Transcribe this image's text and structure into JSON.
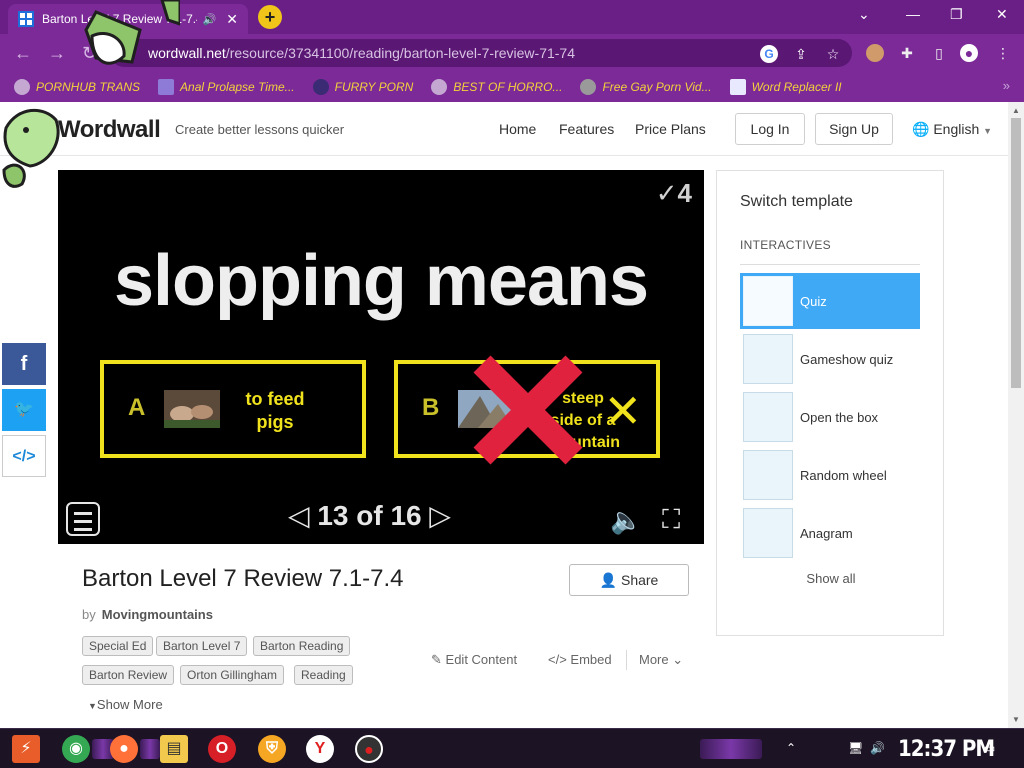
{
  "browser": {
    "tab_title": "Barton Level 7 Review 7.1-7.4",
    "url_host": "wordwall.net",
    "url_path": "/resource/37341100/reading/barton-level-7-review-71-74",
    "bookmarks": [
      {
        "label": "PORNHUB TRANS"
      },
      {
        "label": "Anal Prolapse Time..."
      },
      {
        "label": "FURRY PORN"
      },
      {
        "label": "BEST OF HORRO..."
      },
      {
        "label": "Free Gay Porn Vid..."
      },
      {
        "label": "Word Replacer II"
      }
    ],
    "more_bookmarks": "»"
  },
  "header": {
    "logo": "Wordwall",
    "tagline": "Create better lessons quicker",
    "nav": [
      "Home",
      "Features",
      "Price Plans"
    ],
    "login": "Log In",
    "signup": "Sign Up",
    "language": "English"
  },
  "game": {
    "score": "4",
    "question": "slopping means",
    "answers": [
      {
        "letter": "A",
        "text": "to feed pigs"
      },
      {
        "letter": "B",
        "text": "steep side of a mountain"
      }
    ],
    "page": "13 of 16"
  },
  "activity": {
    "title": "Barton Level 7 Review 7.1-7.4",
    "by_prefix": "by",
    "author": "Movingmountains",
    "share": "Share",
    "tags": [
      "Special Ed",
      "Barton Level 7",
      "Barton Reading",
      "Barton Review",
      "Orton Gillingham",
      "Reading"
    ],
    "show_more": "Show More",
    "actions": {
      "edit": "Edit Content",
      "embed": "Embed",
      "more": "More"
    }
  },
  "panel": {
    "title": "Switch template",
    "section": "INTERACTIVES",
    "templates": [
      {
        "name": "Quiz",
        "selected": true
      },
      {
        "name": "Gameshow quiz"
      },
      {
        "name": "Open the box"
      },
      {
        "name": "Random wheel"
      },
      {
        "name": "Anagram"
      }
    ],
    "show_all": "Show all"
  },
  "taskbar": {
    "clock": "12:37 PM"
  },
  "colors": {
    "browser_purple": "#7b2a98",
    "bookmark_text": "#f3d23b",
    "game_yellow": "#f0e21c",
    "cross_red": "#e0223f",
    "selected_blue": "#3fa9f5"
  }
}
